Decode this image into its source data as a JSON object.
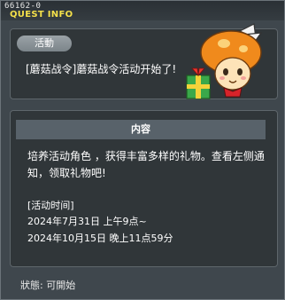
{
  "window": {
    "quest_id": "66162-0",
    "title": "QUEST INFO"
  },
  "top_panel": {
    "tag": "活動",
    "headline": "[蘑菇战令]蘑菇战令活动开始了!"
  },
  "main_panel": {
    "section_title": "内容",
    "description": "培养活动角色 ，获得丰富多样的礼物。查看左侧通知，领取礼物吧!",
    "period_label": "[活动时间]",
    "period_start": "2024年7月31日 上午9点~",
    "period_end": "2024年10月15日 晚上11点59分"
  },
  "status": {
    "text": "狀態: 可開始"
  },
  "colors": {
    "title": "#f4e04a",
    "panel_bg": "#303639",
    "header_bg": "#58626a"
  },
  "icons": {
    "mascot": "orange-mushroom-with-gift-icon"
  }
}
